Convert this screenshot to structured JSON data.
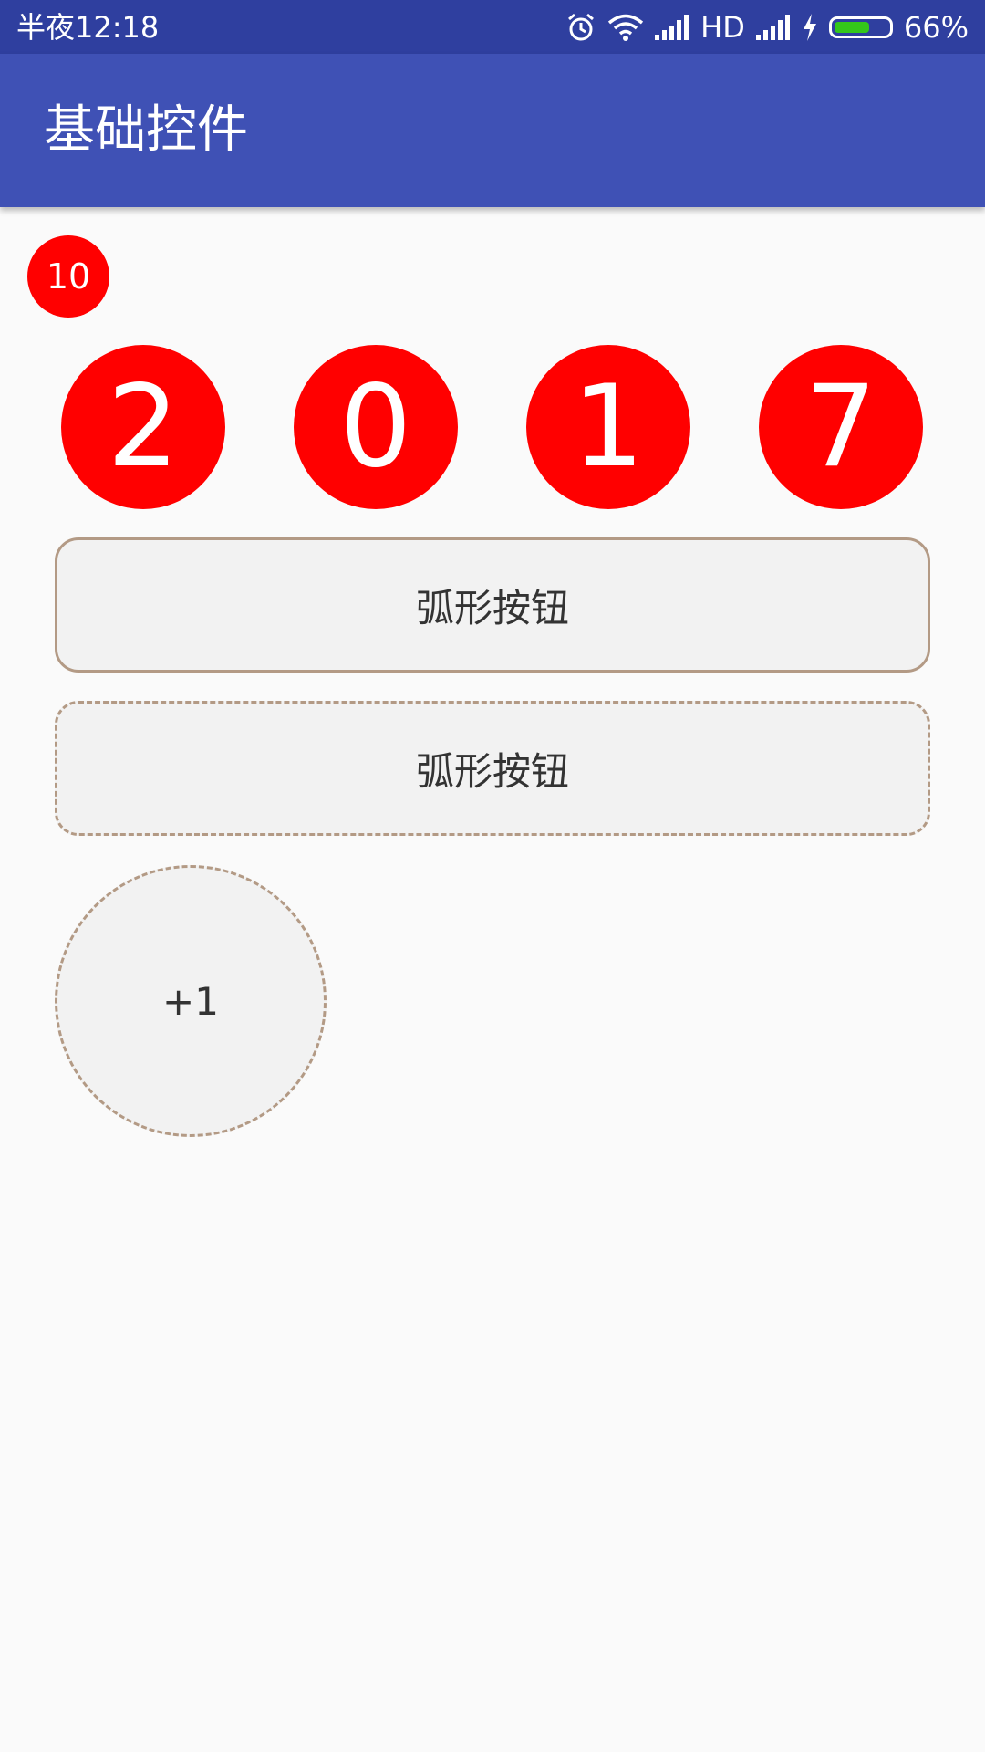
{
  "status_bar": {
    "time": "半夜12:18",
    "network_label": "HD",
    "battery_percent": "66%",
    "battery_level": 0.66,
    "icons": [
      "alarm-icon",
      "wifi-icon",
      "signal-icon",
      "signal-icon",
      "charging-icon",
      "battery-icon"
    ]
  },
  "app_bar": {
    "title": "基础控件"
  },
  "badge": {
    "count": "10",
    "color": "#ff0000"
  },
  "year_digits": [
    "2",
    "0",
    "1",
    "7"
  ],
  "buttons": {
    "arc_solid_label": "弧形按钮",
    "arc_dashed_label": "弧形按钮",
    "circle_label": "+1"
  },
  "colors": {
    "status_bar": "#2f3f9f",
    "app_bar": "#3f51b5",
    "accent_red": "#ff0000",
    "button_border": "#b39a85",
    "button_bg": "#f2f2f2"
  }
}
